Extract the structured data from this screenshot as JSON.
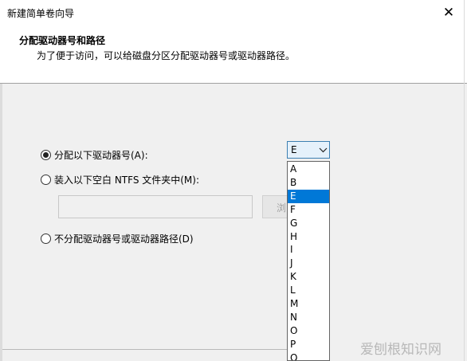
{
  "window": {
    "title": "新建简单卷向导",
    "close_glyph": "✕"
  },
  "header": {
    "title": "分配驱动器号和路径",
    "description": "为了便于访问，可以给磁盘分区分配驱动器号或驱动器路径。"
  },
  "options": {
    "assign_letter": {
      "label": "分配以下驱动器号(A):",
      "checked": true
    },
    "mount_folder": {
      "label": "装入以下空白 NTFS 文件夹中(M):",
      "checked": false
    },
    "no_assign": {
      "label": "不分配驱动器号或驱动器路径(D)",
      "checked": false
    }
  },
  "drive_select": {
    "selected": "E",
    "options": [
      "A",
      "B",
      "E",
      "F",
      "G",
      "H",
      "I",
      "J",
      "K",
      "L",
      "M",
      "N",
      "O",
      "P",
      "Q"
    ]
  },
  "path_input": {
    "value": ""
  },
  "browse_button": {
    "label": "浏"
  },
  "watermark": {
    "text": "爱刨根知识网"
  },
  "colors": {
    "selection": "#0078d7",
    "select_border": "#3c7fb1",
    "select_bg": "#e5f1fb"
  },
  "icons": {
    "chevron": "chevron-down-icon",
    "close": "close-icon"
  }
}
